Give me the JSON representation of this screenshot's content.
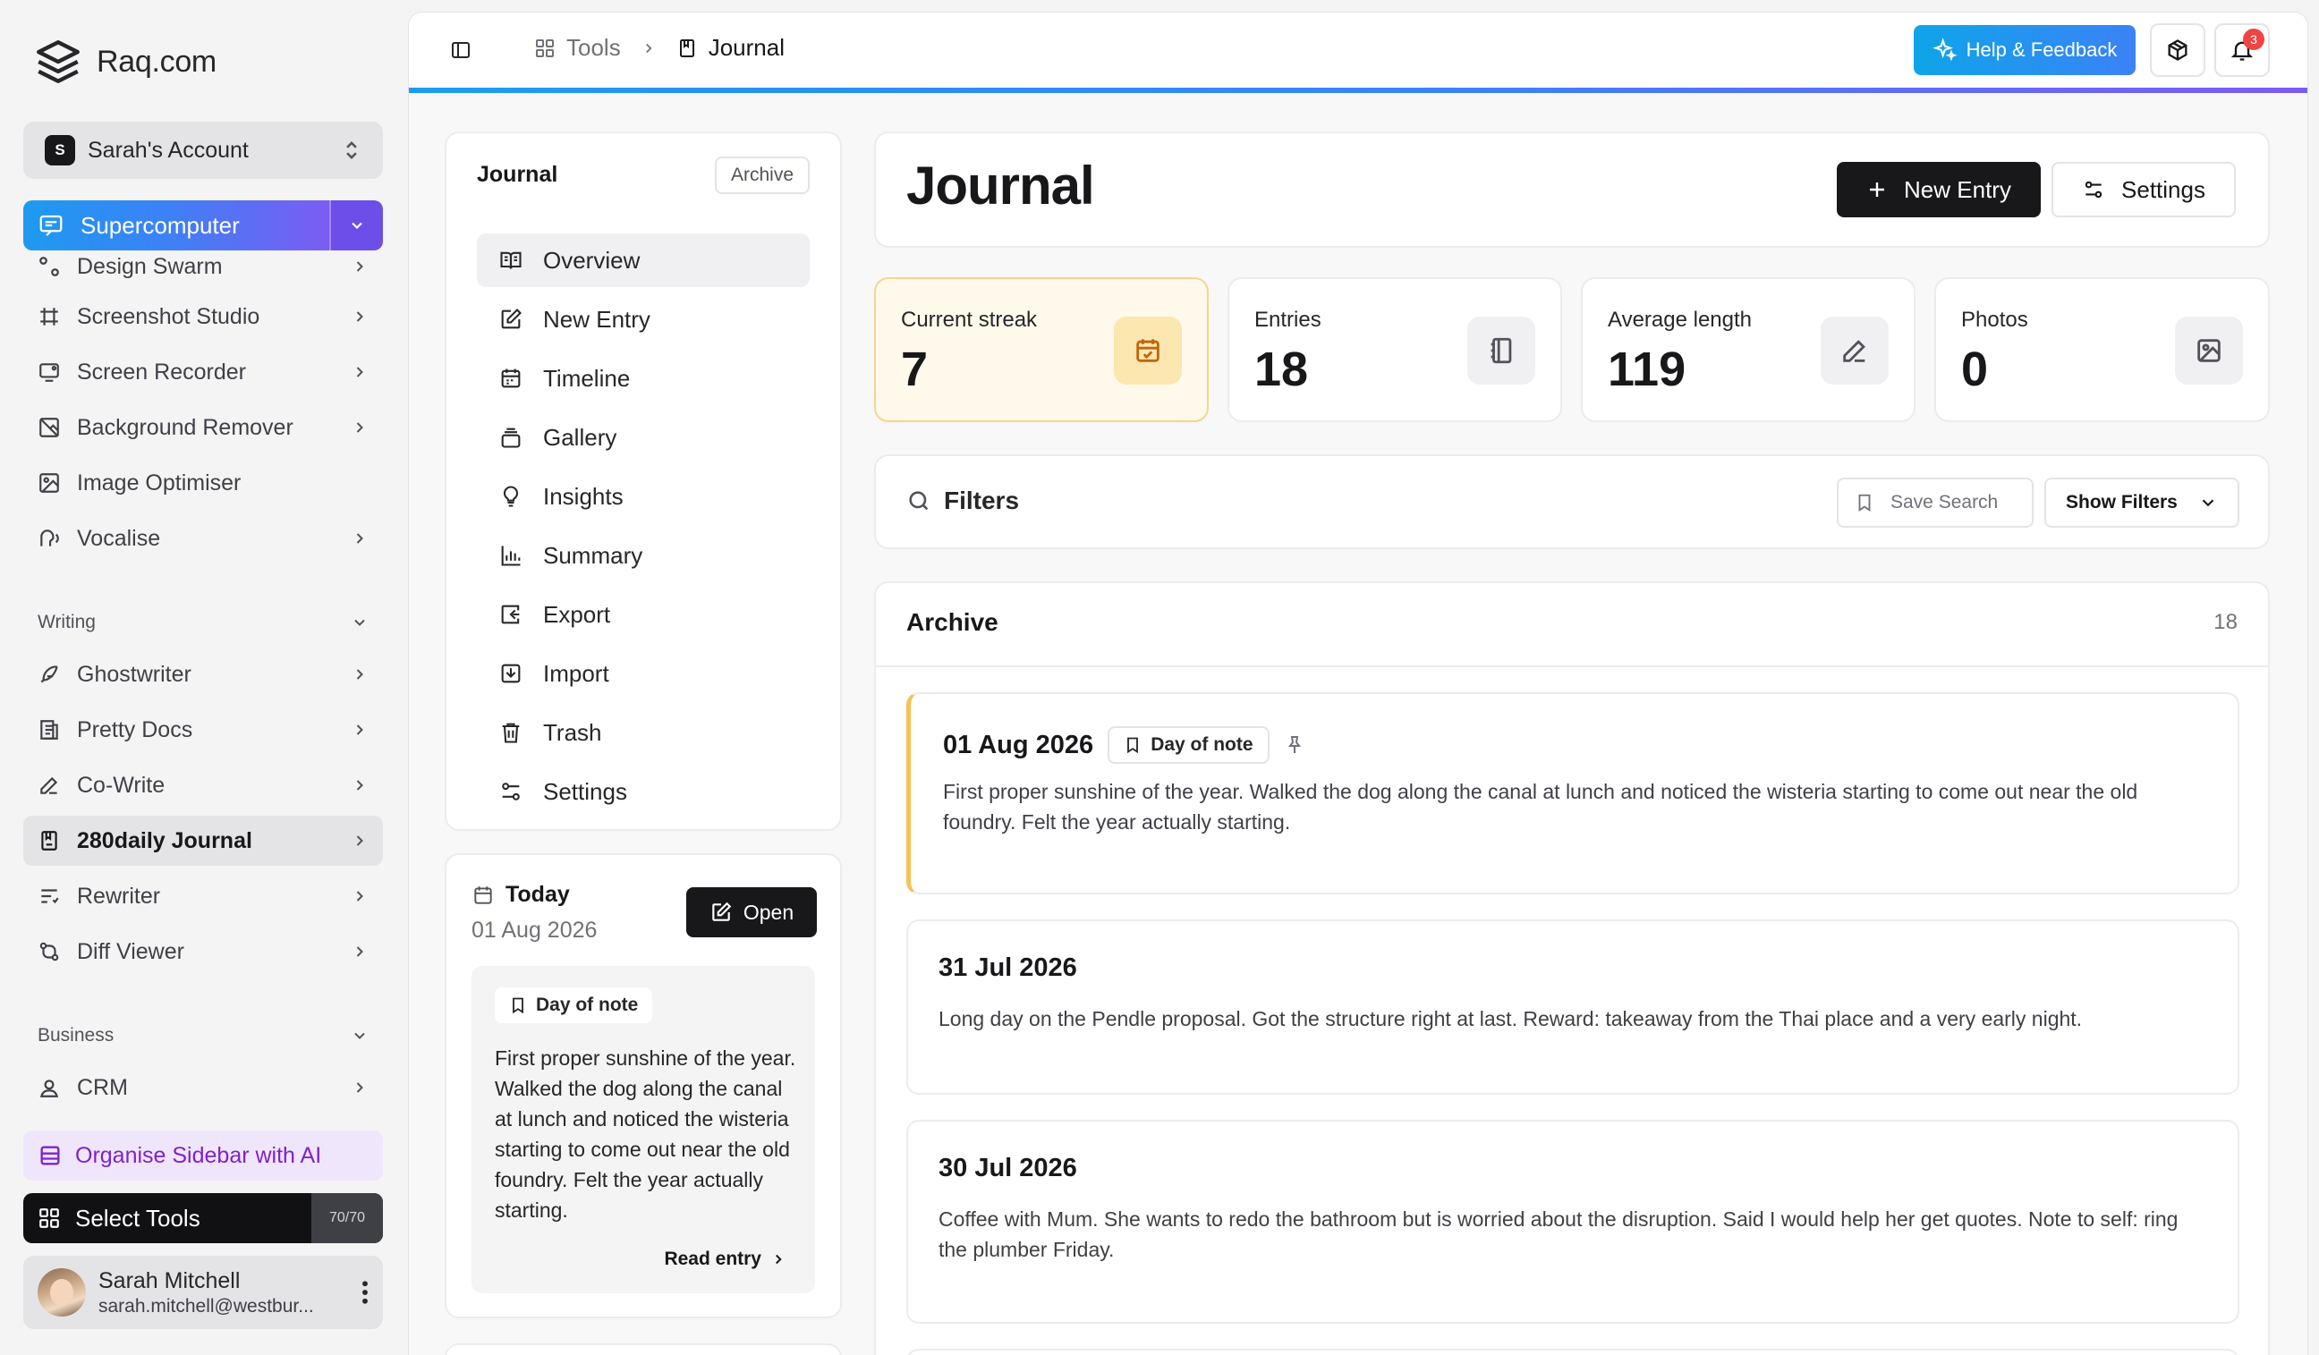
{
  "brand": {
    "name": "Raq.com"
  },
  "account": {
    "initial": "S",
    "name": "Sarah's Account"
  },
  "supercomputer": {
    "label": "Supercomputer"
  },
  "sidebar": {
    "items_top": [
      {
        "label": "Design Swarm",
        "icon": "swarm-icon"
      },
      {
        "label": "Screenshot Studio",
        "icon": "frame-icon"
      },
      {
        "label": "Screen Recorder",
        "icon": "screen-record-icon"
      },
      {
        "label": "Background Remover",
        "icon": "image-off-icon"
      },
      {
        "label": "Image Optimiser",
        "icon": "image-icon"
      },
      {
        "label": "Vocalise",
        "icon": "speech-icon"
      }
    ],
    "writing_label": "Writing",
    "writing_items": [
      {
        "label": "Ghostwriter",
        "icon": "feather-icon"
      },
      {
        "label": "Pretty Docs",
        "icon": "docs-icon"
      },
      {
        "label": "Co-Write",
        "icon": "pen-icon"
      },
      {
        "label": "280daily Journal",
        "icon": "journal-icon"
      },
      {
        "label": "Rewriter",
        "icon": "text-lines-icon"
      },
      {
        "label": "Diff Viewer",
        "icon": "diff-icon"
      }
    ],
    "business_label": "Business",
    "business_items": [
      {
        "label": "CRM",
        "icon": "contact-icon"
      }
    ],
    "organise_label": "Organise Sidebar with AI",
    "select_tools_label": "Select Tools",
    "select_tools_count": "70/70"
  },
  "user": {
    "name": "Sarah Mitchell",
    "email": "sarah.mitchell@westbur..."
  },
  "topbar": {
    "crumb_tools": "Tools",
    "crumb_current": "Journal",
    "help_label": "Help & Feedback",
    "notifications": "3"
  },
  "journal_nav": {
    "title": "Journal",
    "archive_chip": "Archive",
    "items": [
      {
        "label": "Overview",
        "icon": "book-open-icon"
      },
      {
        "label": "New Entry",
        "icon": "edit-icon"
      },
      {
        "label": "Timeline",
        "icon": "calendar-icon"
      },
      {
        "label": "Gallery",
        "icon": "gallery-icon"
      },
      {
        "label": "Insights",
        "icon": "lightbulb-icon"
      },
      {
        "label": "Summary",
        "icon": "bar-chart-icon"
      },
      {
        "label": "Export",
        "icon": "export-icon"
      },
      {
        "label": "Import",
        "icon": "import-icon"
      },
      {
        "label": "Trash",
        "icon": "trash-icon"
      },
      {
        "label": "Settings",
        "icon": "settings-icon"
      }
    ]
  },
  "today": {
    "title": "Today",
    "date": "01 Aug 2026",
    "open_label": "Open",
    "chip": "Day of note",
    "text": "First proper sunshine of the year. Walked the dog along the canal at lunch and noticed the wisteria starting to come out near the old foundry. Felt the year actually starting.",
    "read_entry": "Read entry"
  },
  "header": {
    "title": "Journal",
    "new_entry_label": "New Entry",
    "settings_label": "Settings"
  },
  "stats": [
    {
      "label": "Current streak",
      "value": "7",
      "icon": "calendar-check-icon"
    },
    {
      "label": "Entries",
      "value": "18",
      "icon": "notebook-icon"
    },
    {
      "label": "Average length",
      "value": "119",
      "icon": "pencil-icon"
    },
    {
      "label": "Photos",
      "value": "0",
      "icon": "photo-icon"
    }
  ],
  "filters": {
    "label": "Filters",
    "save_search": "Save Search",
    "show_filters": "Show Filters"
  },
  "archive": {
    "title": "Archive",
    "count": "18",
    "entries": [
      {
        "date": "01 Aug 2026",
        "chip": "Day of note",
        "text": "First proper sunshine of the year. Walked the dog along the canal at lunch and noticed the wisteria starting to come out near the old foundry. Felt the year actually starting."
      },
      {
        "date": "31 Jul 2026",
        "text": "Long day on the Pendle proposal. Got the structure right at last. Reward: takeaway from the Thai place and a very early night."
      },
      {
        "date": "30 Jul 2026",
        "text": "Coffee with Mum. She wants to redo the bathroom but is worried about the disruption. Said I would help her get quotes. Note to self: ring the plumber Friday."
      }
    ]
  },
  "colors": {
    "accent_blue": "#1d9bf0",
    "accent_purple": "#7c5cf3",
    "highlight": "#f6c155",
    "dark": "#18181b"
  }
}
